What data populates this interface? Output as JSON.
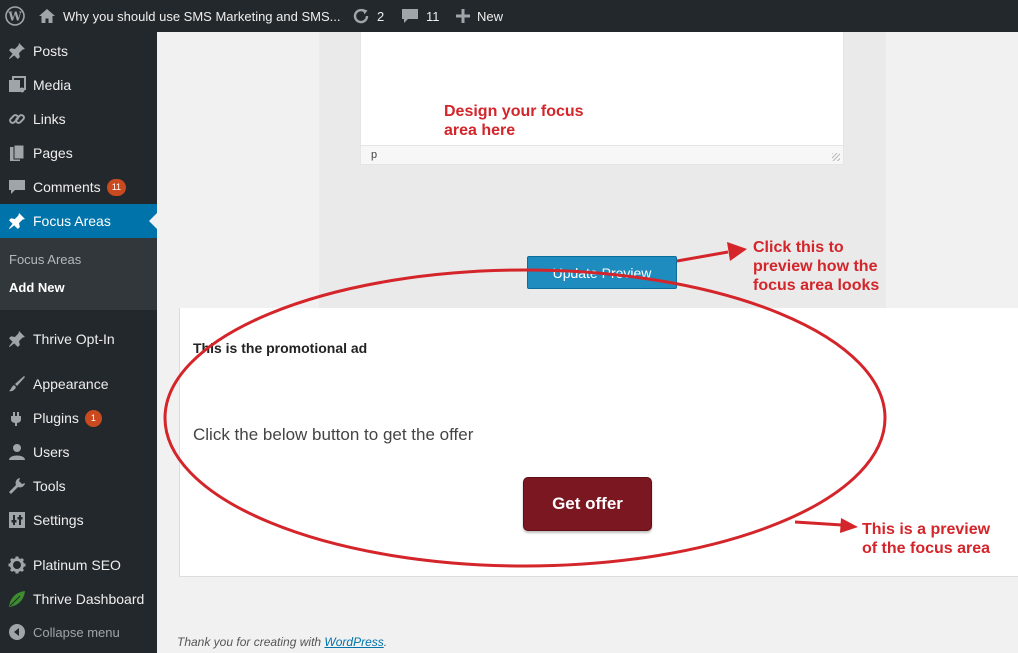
{
  "admin_bar": {
    "wp_logo_icon": "wordpress-logo-icon",
    "site_title": "Why you should use SMS Marketing and SMS...",
    "updates_count": "2",
    "comments_count": "11",
    "new_label": "New"
  },
  "sidebar": {
    "items": [
      {
        "label": "Posts",
        "icon": "pin-icon"
      },
      {
        "label": "Media",
        "icon": "media-icon"
      },
      {
        "label": "Links",
        "icon": "link-icon"
      },
      {
        "label": "Pages",
        "icon": "pages-icon"
      },
      {
        "label": "Comments",
        "icon": "comment-icon",
        "badge": "11"
      },
      {
        "label": "Focus Areas",
        "icon": "pin-icon",
        "current": true
      },
      {
        "label": "Thrive Opt-In",
        "icon": "pin-icon"
      },
      {
        "label": "Appearance",
        "icon": "paintbrush-icon"
      },
      {
        "label": "Plugins",
        "icon": "plugin-icon",
        "badge": "1"
      },
      {
        "label": "Users",
        "icon": "users-icon"
      },
      {
        "label": "Tools",
        "icon": "wrench-icon"
      },
      {
        "label": "Settings",
        "icon": "settings-icon"
      },
      {
        "label": "Platinum SEO",
        "icon": "gear-icon"
      },
      {
        "label": "Thrive Dashboard",
        "icon": "leaf-icon"
      }
    ],
    "submenu": [
      "Focus Areas",
      "Add New"
    ],
    "collapse_label": "Collapse menu"
  },
  "editor": {
    "note": "Design your focus area here",
    "status_path": "p"
  },
  "update_button": "Update Preview",
  "preview": {
    "title": "This is the promotional ad",
    "text": "Click the below button to get the offer",
    "button": "Get offer"
  },
  "annotations": {
    "click_note": "Click this to preview how the focus area looks",
    "preview_note": "This is a preview of the focus area",
    "color": "#d3252a"
  },
  "footer": {
    "prefix": "Thank you for creating with ",
    "link": "WordPress",
    "suffix": "."
  }
}
